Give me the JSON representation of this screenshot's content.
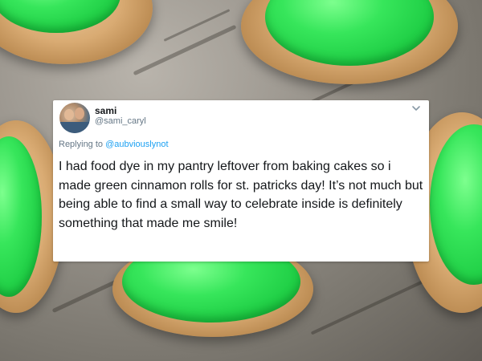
{
  "tweet": {
    "display_name": "sami",
    "handle": "@sami_caryl",
    "replying_prefix": "Replying to ",
    "replying_to": "@aubviouslynot",
    "text": "I had food dye in my pantry leftover from baking cakes so i made green cinnamon rolls for st. patricks day! It’s not much but being able to find a small way to celebrate inside is definitely something that made me smile!"
  },
  "colors": {
    "icing": "#2fdc55",
    "link": "#1da1f2",
    "text": "#14171a",
    "muted": "#657786"
  },
  "icons": {
    "menu": "chevron-down-icon"
  }
}
